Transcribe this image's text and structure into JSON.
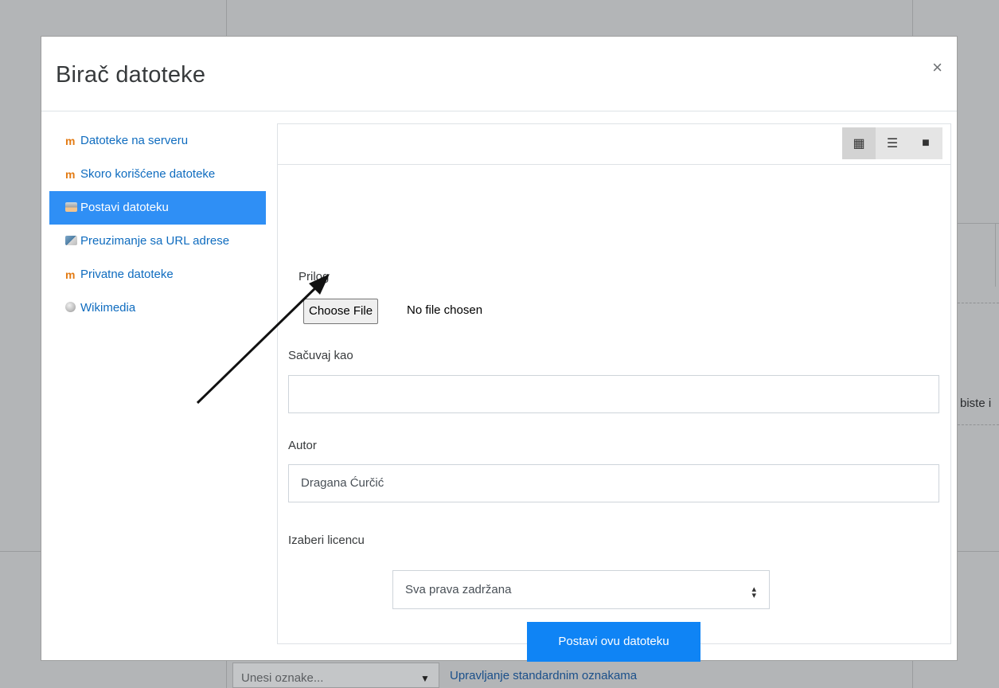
{
  "background": {
    "right_text": "biste i",
    "tags_placeholder": "Unesi oznake...",
    "tags_dropdown_icon": "triangle-down-icon",
    "manage_tags_link": "Upravljanje standardnim oznakama"
  },
  "dialog": {
    "title": "Birač datoteke",
    "close_label": "×",
    "repositories": [
      {
        "label": "Datoteke na serveru",
        "icon": "moodle-icon"
      },
      {
        "label": "Skoro korišćene datoteke",
        "icon": "moodle-icon"
      },
      {
        "label": "Postavi datoteku",
        "icon": "upload-icon",
        "active": true
      },
      {
        "label": "Preuzimanje sa URL adrese",
        "icon": "url-download-icon"
      },
      {
        "label": "Privatne datoteke",
        "icon": "moodle-icon"
      },
      {
        "label": "Wikimedia",
        "icon": "wikimedia-icon"
      }
    ],
    "view_buttons": [
      {
        "name": "icons-view-icon",
        "glyph": "▦"
      },
      {
        "name": "list-view-icon",
        "glyph": "☰"
      },
      {
        "name": "tree-view-icon",
        "glyph": "■"
      }
    ],
    "form": {
      "attachment_label": "Prilog",
      "choose_file_label": "Choose File",
      "no_file_text": "No file chosen",
      "save_as_label": "Sačuvaj kao",
      "save_as_value": "",
      "author_label": "Autor",
      "author_value": "Dragana Ćurčić",
      "license_label": "Izaberi licencu",
      "license_value": "Sva prava zadržana",
      "submit_label": "Postavi ovu datoteku"
    }
  },
  "colors": {
    "accent": "#0f84f5",
    "active_item": "#2f8ff5",
    "link": "#0f6cbf",
    "overlay": "#b3b5b7"
  }
}
